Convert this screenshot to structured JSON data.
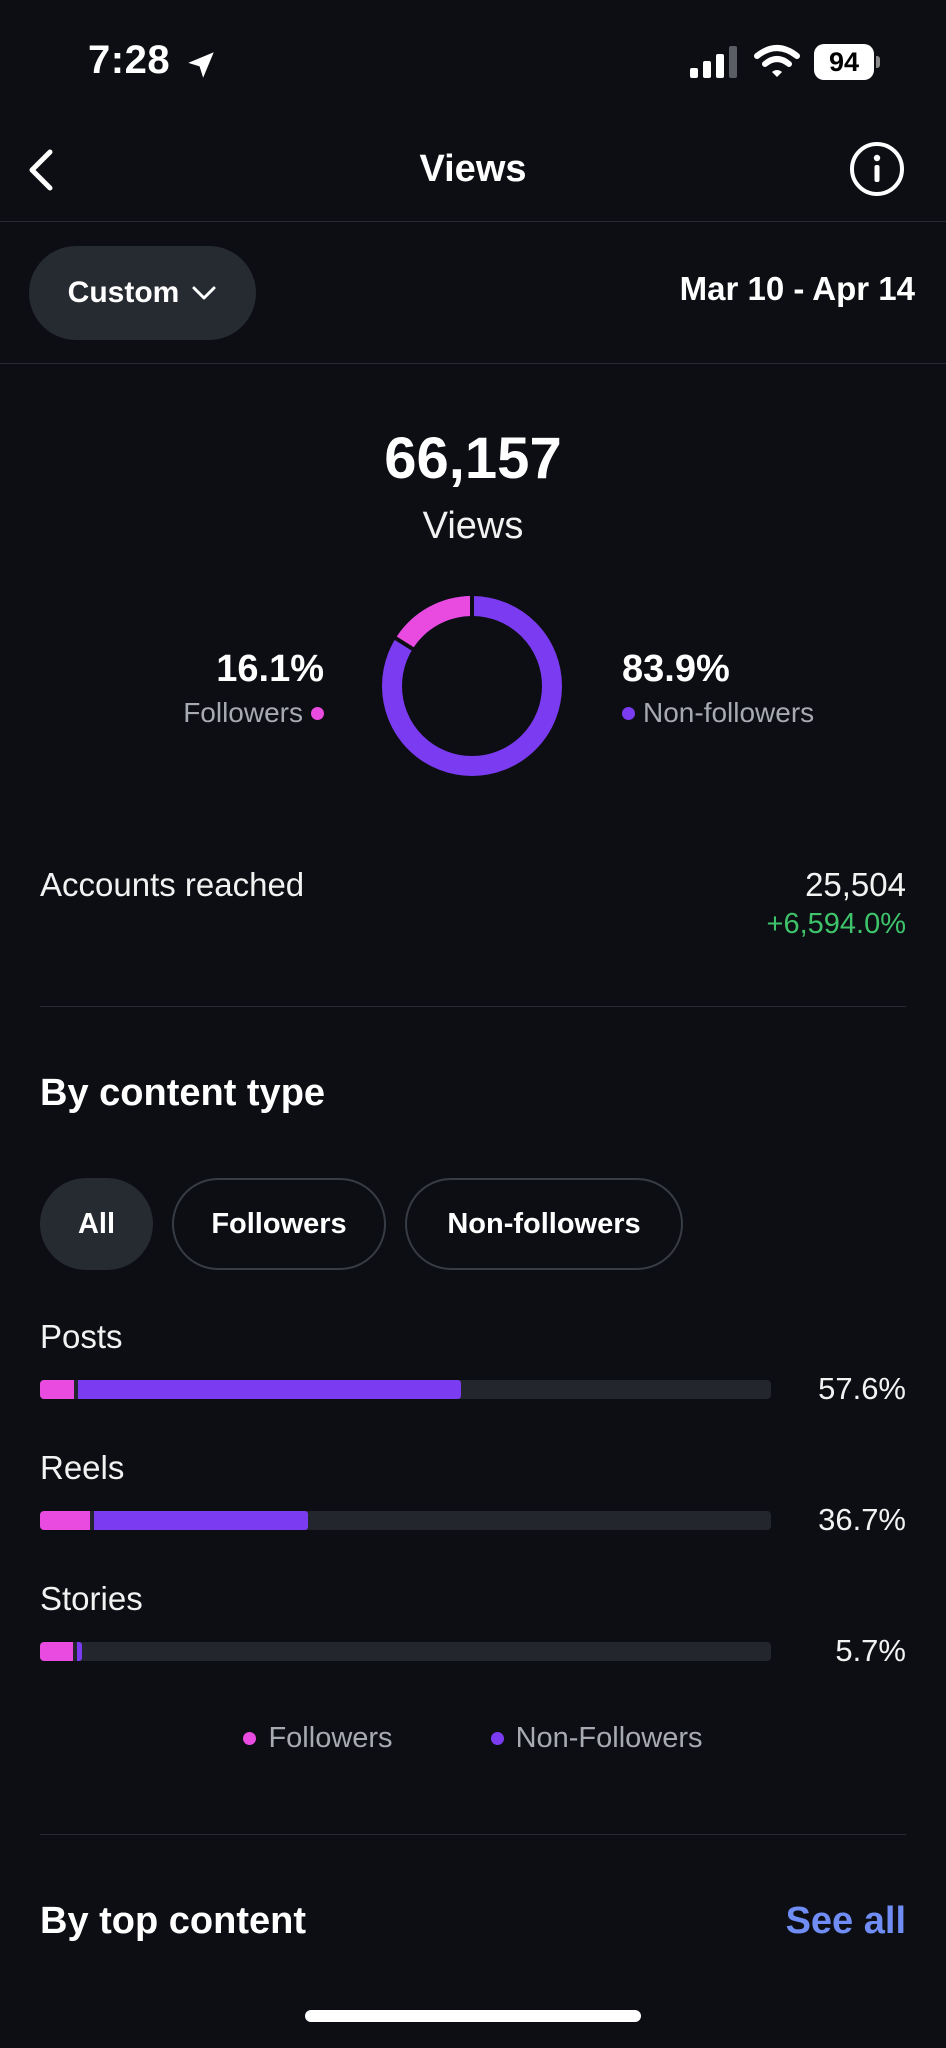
{
  "status_bar": {
    "time": "7:28",
    "battery": "94",
    "icons": [
      "location-arrow-icon",
      "cellular-signal-icon",
      "wifi-icon",
      "battery-icon"
    ]
  },
  "nav": {
    "title": "Views",
    "back_icon": "chevron-left-icon",
    "info_icon": "info-icon"
  },
  "filter": {
    "range_label": "Custom",
    "date_range": "Mar 10 - Apr 14"
  },
  "summary": {
    "total": "66,157",
    "label": "Views",
    "followers_pct": "16.1%",
    "followers_label": "Followers",
    "nonfollowers_pct": "83.9%",
    "nonfollowers_label": "Non-followers",
    "followers_fraction": 0.161
  },
  "accounts_reached": {
    "label": "Accounts reached",
    "value": "25,504",
    "change": "+6,594.0%"
  },
  "by_content_type": {
    "title": "By content type",
    "filters": [
      {
        "label": "All",
        "active": true
      },
      {
        "label": "Followers",
        "active": false
      },
      {
        "label": "Non-followers",
        "active": false
      }
    ],
    "rows": [
      {
        "label": "Posts",
        "pct": "57.6%",
        "total": 57.6,
        "followers_part": 4.6
      },
      {
        "label": "Reels",
        "pct": "36.7%",
        "total": 36.7,
        "followers_part": 6.8
      },
      {
        "label": "Stories",
        "pct": "5.7%",
        "total": 5.7,
        "followers_part": 4.5
      }
    ],
    "legend": [
      "Followers",
      "Non-Followers"
    ]
  },
  "top_content": {
    "title": "By top content",
    "see_all": "See all"
  },
  "colors": {
    "background": "#0c0e13",
    "followers": "#e94ae0",
    "non_followers": "#7b3bf0",
    "positive_change": "#3ec26a",
    "link": "#6f8df5"
  }
}
